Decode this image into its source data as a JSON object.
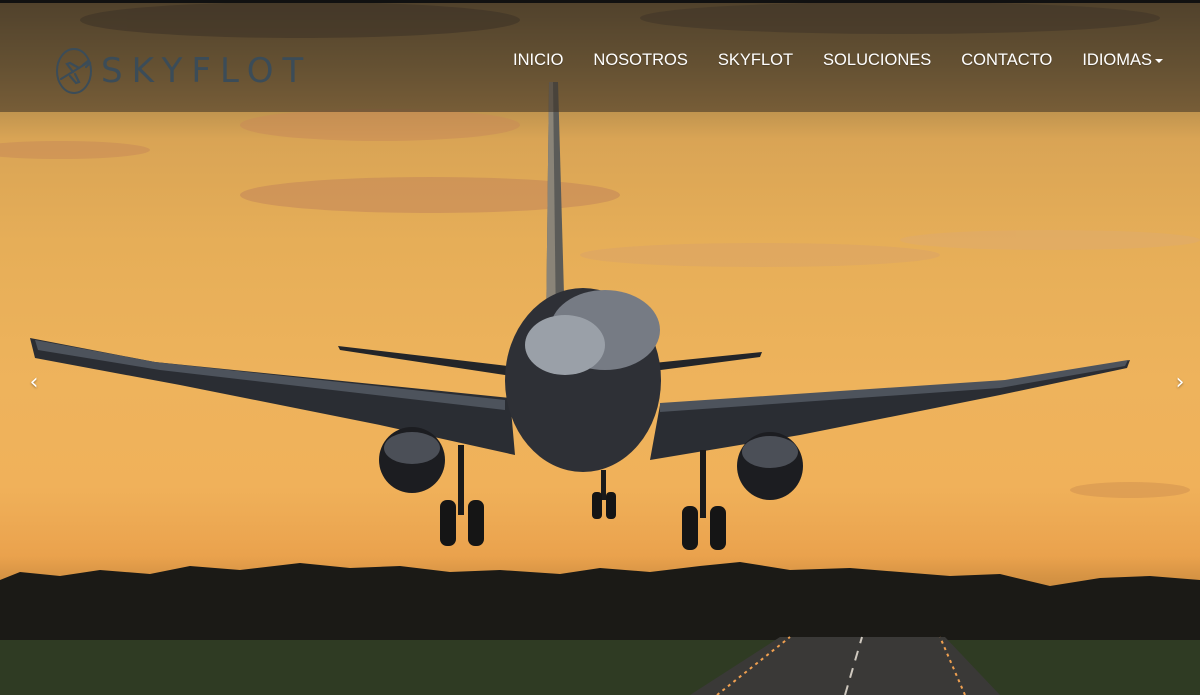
{
  "brand": {
    "name": "SKYFLOT"
  },
  "nav": {
    "items": [
      {
        "label": "INICIO"
      },
      {
        "label": "NOSOTROS"
      },
      {
        "label": "SKYFLOT"
      },
      {
        "label": "SOLUCIONES"
      },
      {
        "label": "CONTACTO"
      },
      {
        "label": "IDIOMAS",
        "has_dropdown": true
      }
    ]
  },
  "carousel": {
    "prev_label": "‹",
    "next_label": "›"
  },
  "colors": {
    "navbar_overlay": "#3a3024",
    "logo_text": "#3b4c58",
    "nav_text": "#ffffff",
    "sky_gold": "#eeb35c"
  },
  "icons": {
    "logo": "airplane-circle-icon",
    "dropdown": "caret-down-icon",
    "prev": "chevron-left-icon",
    "next": "chevron-right-icon"
  }
}
